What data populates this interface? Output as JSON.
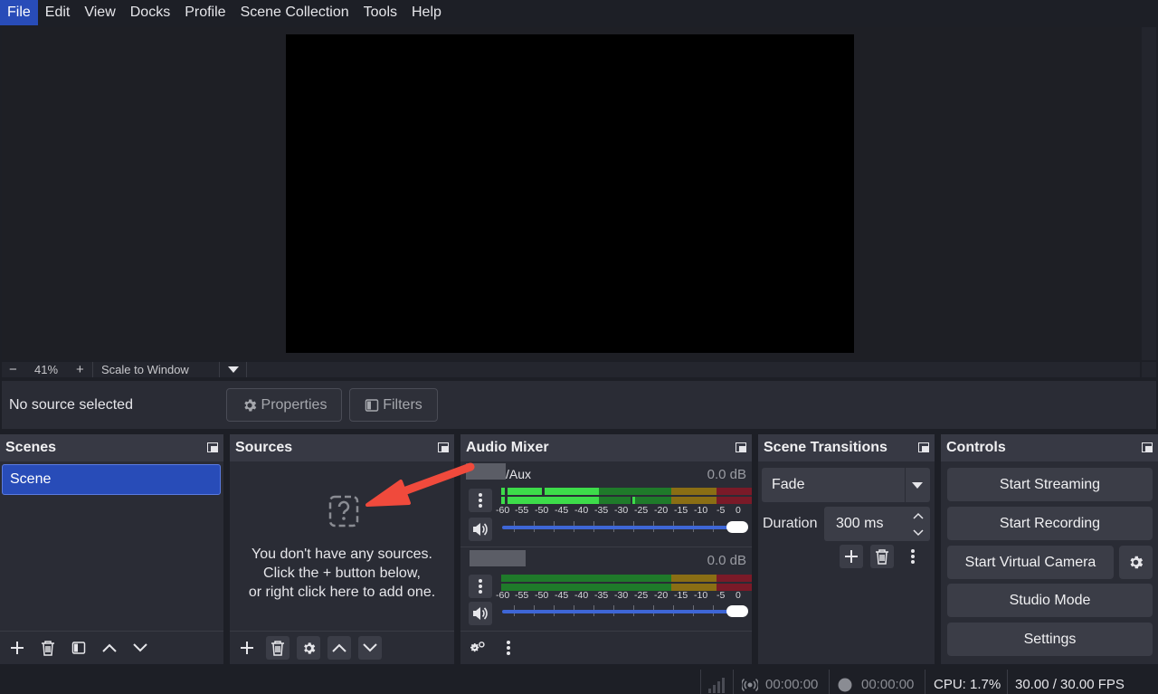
{
  "menu": [
    "File",
    "Edit",
    "View",
    "Docks",
    "Profile",
    "Scene Collection",
    "Tools",
    "Help"
  ],
  "zoom": {
    "minus": "−",
    "value": "41%",
    "plus": "+",
    "mode": "Scale to Window"
  },
  "source_bar": {
    "status": "No source selected",
    "properties": "Properties",
    "filters": "Filters"
  },
  "scenes": {
    "title": "Scenes",
    "items": [
      "Scene"
    ]
  },
  "sources": {
    "title": "Sources",
    "empty_line1": "You don't have any sources.",
    "empty_line2": "Click the + button below,",
    "empty_line3": "or right click here to add one."
  },
  "mixer": {
    "title": "Audio Mixer",
    "channels": [
      {
        "name": "/Aux",
        "db": "0.0 dB"
      },
      {
        "name": "",
        "db": "0.0 dB"
      }
    ],
    "ticks": [
      "-60",
      "-55",
      "-50",
      "-45",
      "-40",
      "-35",
      "-30",
      "-25",
      "-20",
      "-15",
      "-10",
      "-5",
      "0"
    ]
  },
  "transitions": {
    "title": "Scene Transitions",
    "selected": "Fade",
    "duration_label": "Duration",
    "duration_value": "300 ms"
  },
  "controls": {
    "title": "Controls",
    "start_streaming": "Start Streaming",
    "start_recording": "Start Recording",
    "start_virtual_camera": "Start Virtual Camera",
    "studio_mode": "Studio Mode",
    "settings": "Settings"
  },
  "status": {
    "stream_time": "00:00:00",
    "record_time": "00:00:00",
    "cpu": "CPU: 1.7%",
    "fps": "30.00 / 30.00 FPS"
  },
  "colors": {
    "accent": "#284cb8",
    "background": "#1d1f26",
    "panel": "#2a2c35",
    "meter_green": "#3ddc4a",
    "meter_yellow": "#c8a51c",
    "meter_red": "#c0243a",
    "annotation_arrow": "#f04a3c"
  }
}
